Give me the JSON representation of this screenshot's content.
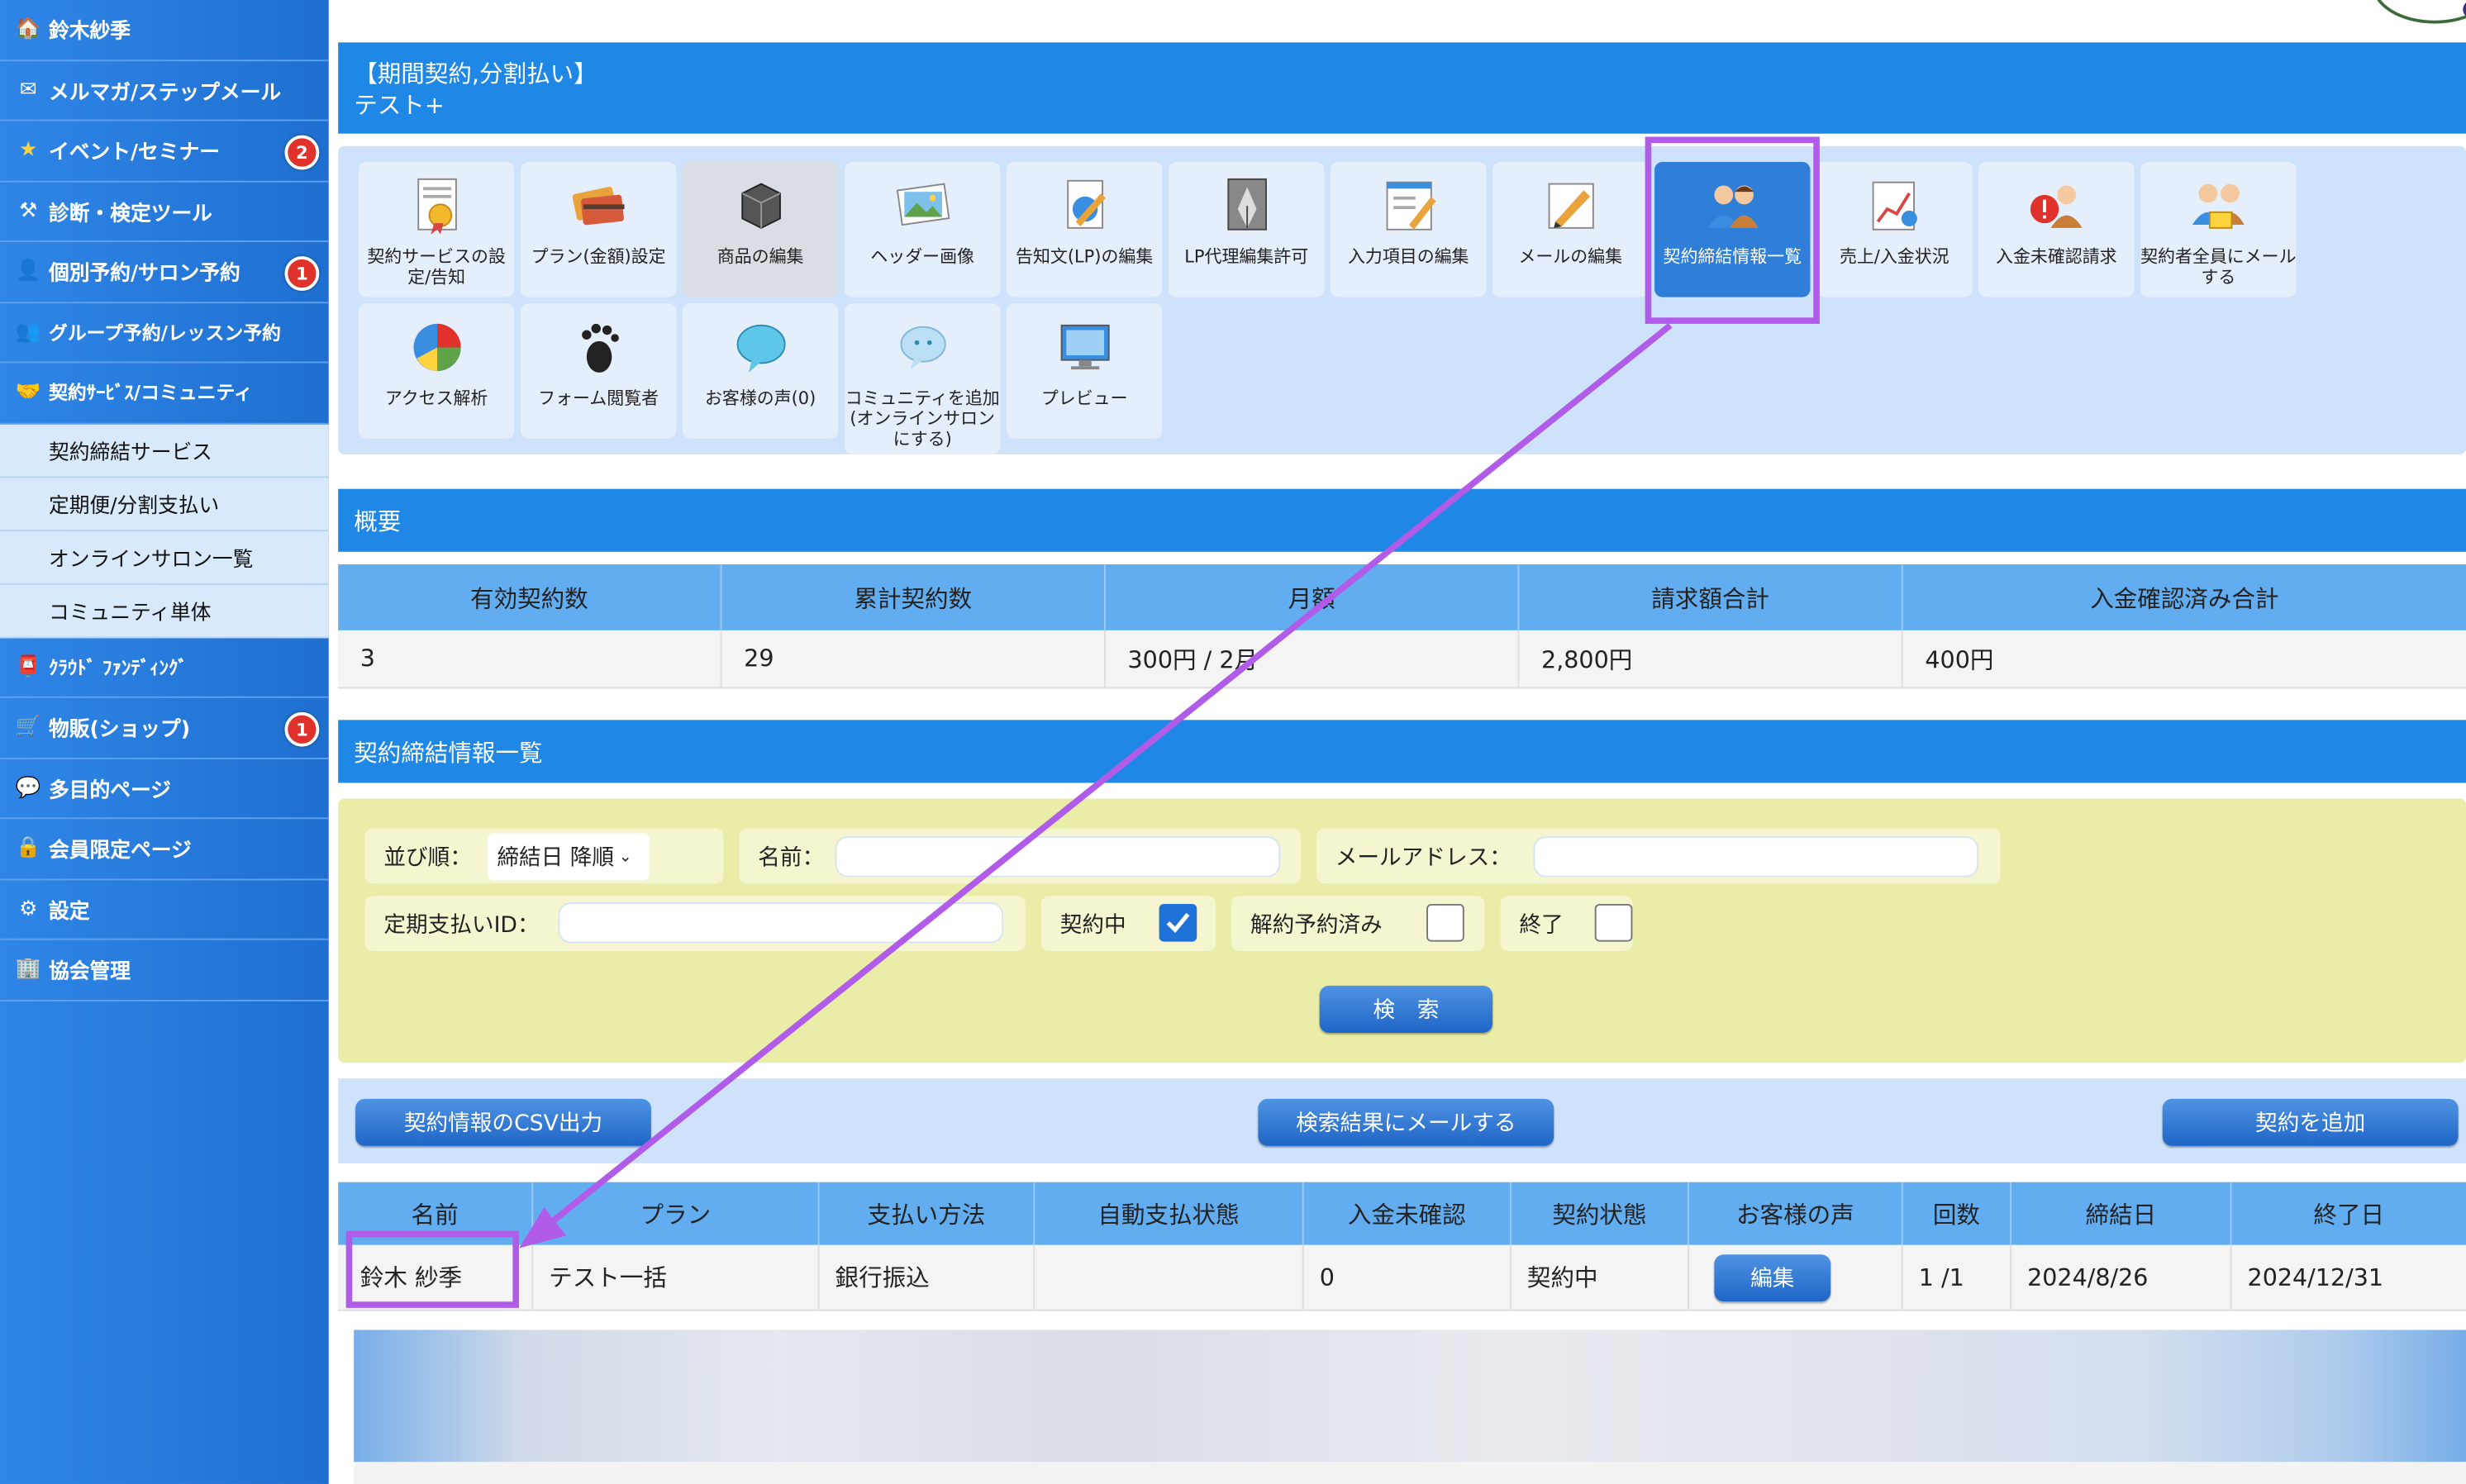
{
  "sidebar": {
    "items": [
      {
        "label": "鈴木紗季",
        "icon": "house-icon"
      },
      {
        "label": "メルマガ/ステップメール",
        "icon": "mail-icon"
      },
      {
        "label": "イベント/セミナー",
        "icon": "star-icon",
        "badge": "2"
      },
      {
        "label": "診断・検定ツール",
        "icon": "tools-icon"
      },
      {
        "label": "個別予約/サロン予約",
        "icon": "person-icon",
        "badge": "1"
      },
      {
        "label": "グループ予約/レッスン予約",
        "icon": "group-icon"
      },
      {
        "label": "契約ｻｰﾋﾞｽ/コミュニティ",
        "icon": "handshake-icon"
      }
    ],
    "subitems": [
      "契約締結サービス",
      "定期便/分割支払い",
      "オンラインサロン一覧",
      "コミュニティ単体"
    ],
    "items2": [
      {
        "label": "ｸﾗｳﾄﾞ ﾌｧﾝﾃﾞｨﾝｸﾞ",
        "icon": "funding-icon"
      },
      {
        "label": "物販(ショップ)",
        "icon": "cart-icon",
        "badge": "1"
      },
      {
        "label": "多目的ページ",
        "icon": "bubble-icon"
      },
      {
        "label": "会員限定ページ",
        "icon": "lock-icon"
      },
      {
        "label": "設定",
        "icon": "gear-icon"
      },
      {
        "label": "協会管理",
        "icon": "building-icon"
      }
    ]
  },
  "header": {
    "title_line1": "【期間契約,分割払い】",
    "title_line2": "テスト+"
  },
  "menu_tiles": [
    {
      "label": "契約サービスの設定/告知",
      "icon": "certificate-icon"
    },
    {
      "label": "プラン(金額)設定",
      "icon": "cards-icon"
    },
    {
      "label": "商品の編集",
      "icon": "box-icon"
    },
    {
      "label": "ヘッダー画像",
      "icon": "picture-icon"
    },
    {
      "label": "告知文(LP)の編集",
      "icon": "document-pen-icon"
    },
    {
      "label": "LP代理編集許可",
      "icon": "fountain-pen-icon"
    },
    {
      "label": "入力項目の編集",
      "icon": "form-icon"
    },
    {
      "label": "メールの編集",
      "icon": "pencil-icon"
    },
    {
      "label": "契約締結情報一覧",
      "icon": "users-icon"
    },
    {
      "label": "売上/入金状況",
      "icon": "chart-icon"
    },
    {
      "label": "入金未確認請求",
      "icon": "alert-users-icon"
    },
    {
      "label": "契約者全員にメールする",
      "icon": "users-mail-icon"
    },
    {
      "label": "アクセス解析",
      "icon": "pie-icon"
    },
    {
      "label": "フォーム閲覧者",
      "icon": "footprint-icon"
    },
    {
      "label": "お客様の声(0)",
      "icon": "speech-icon"
    },
    {
      "label": "コミュニティを追加(オンラインサロンにする)",
      "icon": "chat-icon"
    },
    {
      "label": "プレビュー",
      "icon": "monitor-icon"
    }
  ],
  "summary": {
    "title": "概要",
    "headers": [
      "有効契約数",
      "累計契約数",
      "月額",
      "請求額合計",
      "入金確認済み合計"
    ],
    "values": [
      "3",
      "29",
      "300円 / 2月",
      "2,800円",
      "400円"
    ]
  },
  "list_title": "契約締結情報一覧",
  "filters": {
    "sort_label": "並び順：",
    "sort_value": "締結日 降順",
    "name_label": "名前：",
    "email_label": "メールアドレス：",
    "pay_id_label": "定期支払いID：",
    "active_label": "契約中",
    "active_checked": true,
    "cancel_reserved_label": "解約予約済み",
    "ended_label": "終了",
    "search_button": "検　索"
  },
  "actions": {
    "csv": "契約情報のCSV出力",
    "mail": "検索結果にメールする",
    "add": "契約を追加"
  },
  "table": {
    "headers": [
      "名前",
      "プラン",
      "支払い方法",
      "自動支払状態",
      "入金未確認",
      "契約状態",
      "お客様の声",
      "回数",
      "締結日",
      "終了日"
    ],
    "rows": [
      {
        "name": "鈴木 紗季",
        "plan": "テスト一括",
        "method": "銀行振込",
        "auto": "",
        "unconfirmed": "0",
        "status": "契約中",
        "voice_button": "編集",
        "count": "1 /1",
        "start": "2024/8/26",
        "end": "2024/12/31"
      }
    ]
  },
  "colors": {
    "accent": "#1f87e5",
    "highlight": "#b15ce8",
    "filter_bg": "#e9eda8"
  }
}
